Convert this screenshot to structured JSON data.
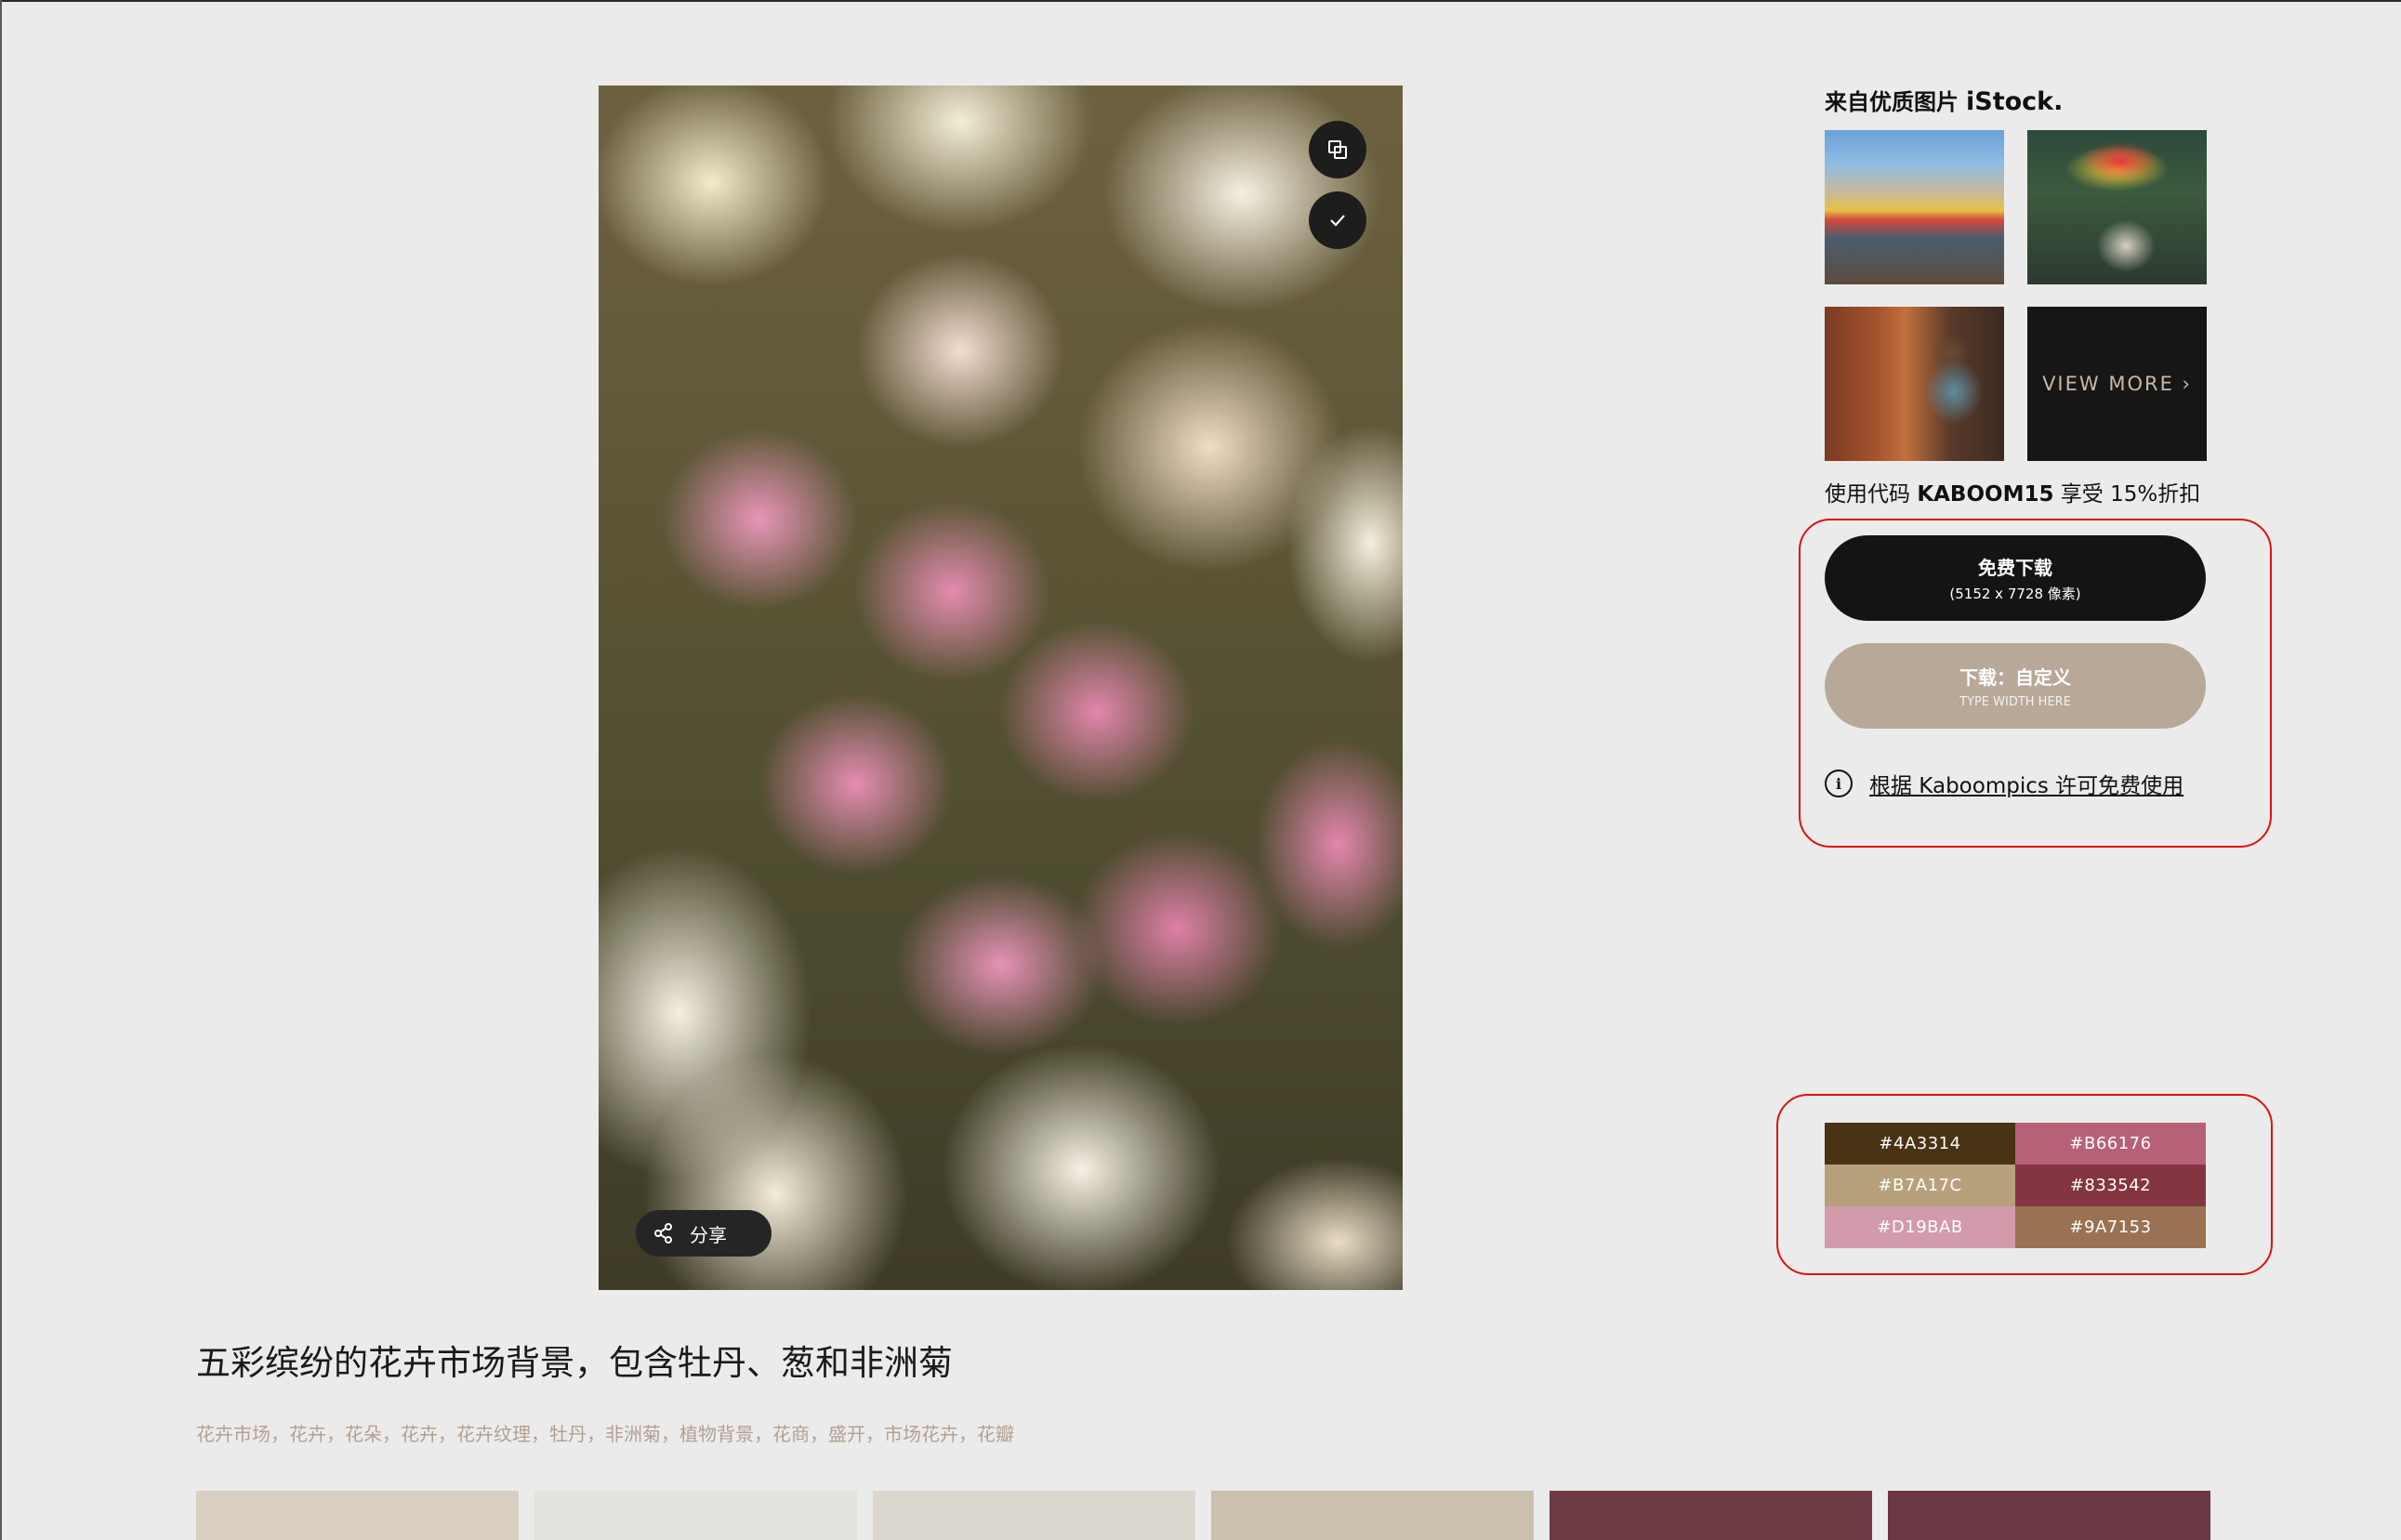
{
  "photo": {
    "share_label": "分享",
    "title": "五彩缤纷的花卉市场背景，包含牡丹、葱和非洲菊",
    "tags": "花卉市场，花卉，花朵，花卉，花卉纹理，牡丹，非洲菊，植物背景，花商，盛开，市场花卉，花瓣"
  },
  "istock": {
    "heading": "来自优质图片",
    "brand": "iStock.",
    "view_more": "VIEW MORE ›",
    "promo_prefix": "使用代码",
    "promo_code": "KABOOM15",
    "promo_suffix": "享受 15%折扣"
  },
  "download": {
    "free_label": "免费下载",
    "free_dims": "(5152 x 7728 像素)",
    "custom_label": "下载：自定义",
    "custom_placeholder": "TYPE WIDTH HERE",
    "license_text": "根据 Kaboompics 许可免费使用"
  },
  "palette": [
    {
      "hex": "#4A3314"
    },
    {
      "hex": "#B66176"
    },
    {
      "hex": "#B7A17C"
    },
    {
      "hex": "#833542"
    },
    {
      "hex": "#D19BAB"
    },
    {
      "hex": "#9A7153"
    }
  ],
  "thumbnails": [
    {
      "color": "#d9cfc2"
    },
    {
      "color": "#e4e2de"
    },
    {
      "color": "#dcd8d0"
    },
    {
      "color": "#cbbfae"
    },
    {
      "color": "#6e3a44"
    },
    {
      "color": "#6a3842"
    }
  ]
}
